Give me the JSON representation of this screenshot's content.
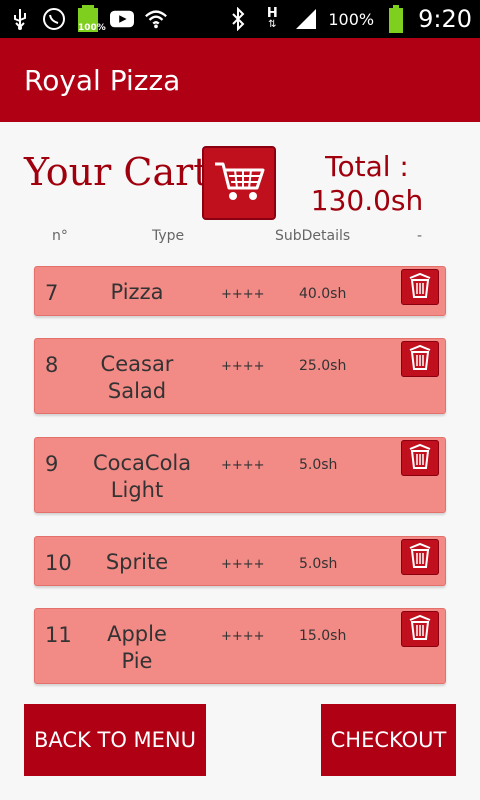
{
  "status_bar": {
    "battery_percent": "100%",
    "time": "9:20",
    "left_battery_badge": "100%",
    "network_h": "H"
  },
  "app": {
    "title": "Royal Pizza"
  },
  "cart": {
    "heading": "Your Cart",
    "total_label": "Total :",
    "total_value": "130.0sh"
  },
  "columns": {
    "num": "n°",
    "type": "Type",
    "subdetails": "SubDetails",
    "action": "-"
  },
  "items": [
    {
      "num": "7",
      "name": "Pizza",
      "extras": "++++",
      "price": "40.0sh"
    },
    {
      "num": "8",
      "name": "Ceasar Salad",
      "extras": "++++",
      "price": "25.0sh"
    },
    {
      "num": "9",
      "name": "CocaCola Light",
      "extras": "++++",
      "price": "5.0sh"
    },
    {
      "num": "10",
      "name": "Sprite",
      "extras": "++++",
      "price": "5.0sh"
    },
    {
      "num": "11",
      "name": "Apple Pie",
      "extras": "++++",
      "price": "15.0sh"
    }
  ],
  "buttons": {
    "back": "BACK TO MENU",
    "checkout": "CHECKOUT"
  },
  "colors": {
    "brand": "#b00014",
    "row": "#f28a86",
    "heading": "#a0000e"
  }
}
